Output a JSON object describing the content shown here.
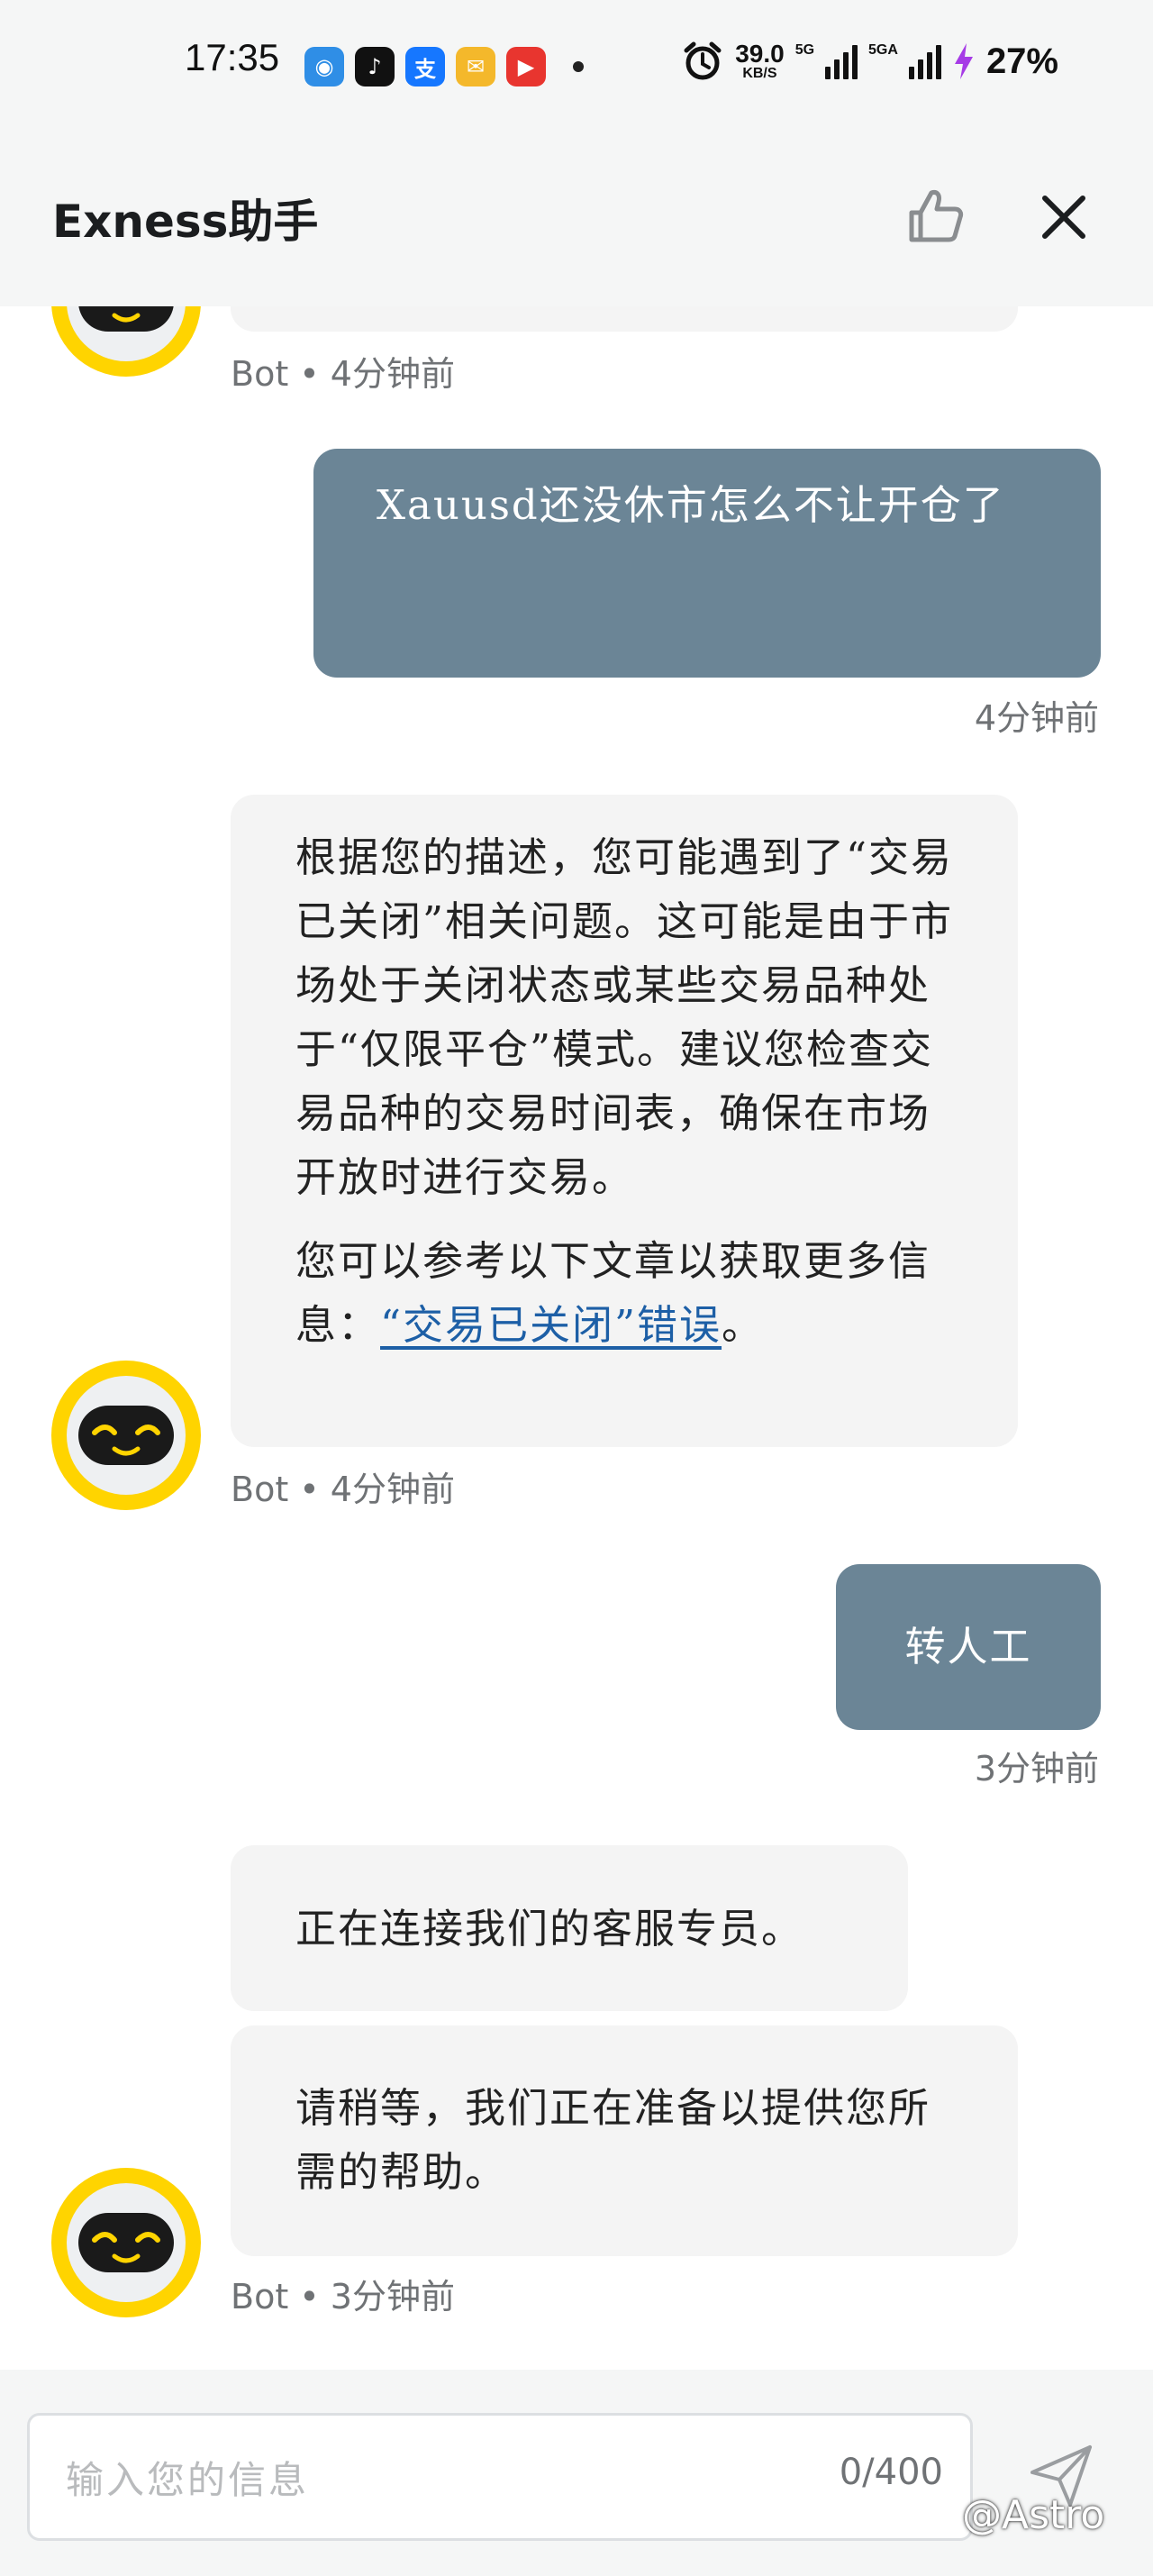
{
  "status_bar": {
    "time": "17:35",
    "apps": [
      {
        "icon": "map-app-icon",
        "glyph": "◉",
        "color": "#2f8ee6"
      },
      {
        "icon": "tiktok-app-icon",
        "glyph": "♪",
        "color": "#111111"
      },
      {
        "icon": "alipay-app-icon",
        "glyph": "支",
        "color": "#1677ff"
      },
      {
        "icon": "mail-app-icon",
        "glyph": "✉",
        "color": "#f4b82b"
      },
      {
        "icon": "video-app-icon",
        "glyph": "▶",
        "color": "#e8352f"
      }
    ],
    "net_speed": "39.0",
    "net_unit": "KB/S",
    "signal_1": "5G",
    "signal_2": "5GA",
    "battery": "27%"
  },
  "header": {
    "title": "Exness助手",
    "like_icon": "thumbs-up-icon",
    "close_icon": "close-icon"
  },
  "messages": {
    "bot_meta_1": "Bot • 4分钟前",
    "user_1": "Xauusd还没休市怎么不让开仓了",
    "user_1_time": "4分钟前",
    "bot_2_p1": "根据您的描述，您可能遇到了“交易已关闭”相关问题。这可能是由于市场处于关闭状态或某些交易品种处于“仅限平仓”模式。建议您检查交易品种的交易时间表，确保在市场开放时进行交易。",
    "bot_2_p2_prefix": "您可以参考以下文章以获取更多信息：",
    "bot_2_link": "“交易已关闭”错误",
    "bot_2_p2_suffix": "。",
    "bot_meta_2": "Bot • 4分钟前",
    "user_2": "转人工",
    "user_2_time": "3分钟前",
    "bot_3": "正在连接我们的客服专员。",
    "bot_4": "请稍等，我们正在准备以提供您所需的帮助。",
    "bot_meta_3": "Bot • 3分钟前"
  },
  "composer": {
    "placeholder": "输入您的信息",
    "counter": "0/400",
    "send_icon": "send-icon"
  },
  "watermark": "@Astro",
  "colors": {
    "user_bubble": "#6b8596",
    "bot_bubble": "#f4f4f4",
    "avatar_ring": "#ffd400",
    "link": "#1d5fa6"
  }
}
